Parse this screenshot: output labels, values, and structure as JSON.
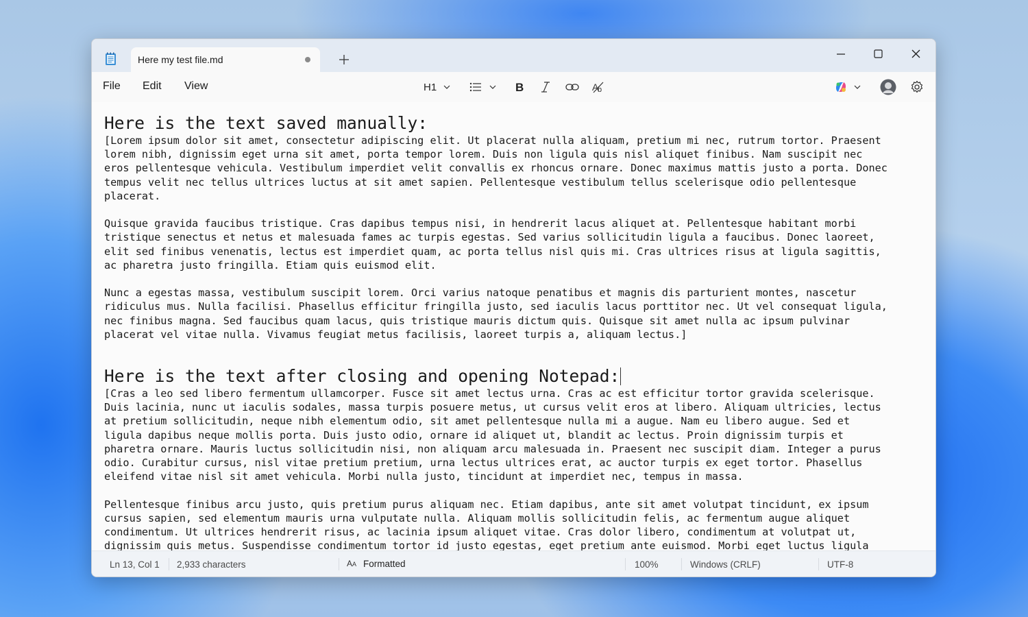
{
  "tab": {
    "title": "Here my test file.md"
  },
  "menu": {
    "file": "File",
    "edit": "Edit",
    "view": "View"
  },
  "toolbar": {
    "heading": "H1"
  },
  "document": {
    "heading1": "Here is the text saved manually:",
    "para1": "[Lorem ipsum dolor sit amet, consectetur adipiscing elit. Ut placerat nulla aliquam, pretium mi nec, rutrum tortor. Praesent\nlorem nibh, dignissim eget urna sit amet, porta tempor lorem. Duis non ligula quis nisl aliquet finibus. Nam suscipit nec\neros pellentesque vehicula. Vestibulum imperdiet velit convallis ex rhoncus ornare. Donec maximus mattis justo a porta. Donec\ntempus velit nec tellus ultrices luctus at sit amet sapien. Pellentesque vestibulum tellus scelerisque odio pellentesque\nplacerat.",
    "para2": "Quisque gravida faucibus tristique. Cras dapibus tempus nisi, in hendrerit lacus aliquet at. Pellentesque habitant morbi\ntristique senectus et netus et malesuada fames ac turpis egestas. Sed varius sollicitudin ligula a faucibus. Donec laoreet,\nelit sed finibus venenatis, lectus est imperdiet quam, ac porta tellus nisl quis mi. Cras ultrices risus at ligula sagittis,\nac pharetra justo fringilla. Etiam quis euismod elit.",
    "para3": "Nunc a egestas massa, vestibulum suscipit lorem. Orci varius natoque penatibus et magnis dis parturient montes, nascetur\nridiculus mus. Nulla facilisi. Phasellus efficitur fringilla justo, sed iaculis lacus porttitor nec. Ut vel consequat ligula,\nnec finibus magna. Sed faucibus quam lacus, quis tristique mauris dictum quis. Quisque sit amet nulla ac ipsum pulvinar\nplacerat vel vitae nulla. Vivamus feugiat metus facilisis, laoreet turpis a, aliquam lectus.]",
    "heading2": "Here is the text after closing and opening Notepad:",
    "para4": "[Cras a leo sed libero fermentum ullamcorper. Fusce sit amet lectus urna. Cras ac est efficitur tortor gravida scelerisque.\nDuis lacinia, nunc ut iaculis sodales, massa turpis posuere metus, ut cursus velit eros at libero. Aliquam ultricies, lectus\nat pretium sollicitudin, neque nibh elementum odio, sit amet pellentesque nulla mi a augue. Nam eu libero augue. Sed et\nligula dapibus neque mollis porta. Duis justo odio, ornare id aliquet ut, blandit ac lectus. Proin dignissim turpis et\npharetra ornare. Mauris luctus sollicitudin nisi, non aliquam arcu malesuada in. Praesent nec suscipit diam. Integer a purus\nodio. Curabitur cursus, nisl vitae pretium pretium, urna lectus ultrices erat, ac auctor turpis ex eget tortor. Phasellus\neleifend vitae nisl sit amet vehicula. Morbi nulla justo, tincidunt at imperdiet nec, tempus in massa.",
    "para5": "Pellentesque finibus arcu justo, quis pretium purus aliquam nec. Etiam dapibus, ante sit amet volutpat tincidunt, ex ipsum\ncursus sapien, sed elementum mauris urna vulputate nulla. Aliquam mollis sollicitudin felis, ac fermentum augue aliquet\ncondimentum. Ut ultrices hendrerit risus, ac lacinia ipsum aliquet vitae. Cras dolor libero, condimentum at volutpat ut,\ndignissim quis metus. Suspendisse condimentum tortor id justo egestas, eget pretium ante euismod. Morbi eget luctus ligula"
  },
  "status": {
    "position": "Ln 13, Col 1",
    "characters": "2,933 characters",
    "format": "Formatted",
    "zoom": "100%",
    "line_ending": "Windows (CRLF)",
    "encoding": "UTF-8"
  }
}
